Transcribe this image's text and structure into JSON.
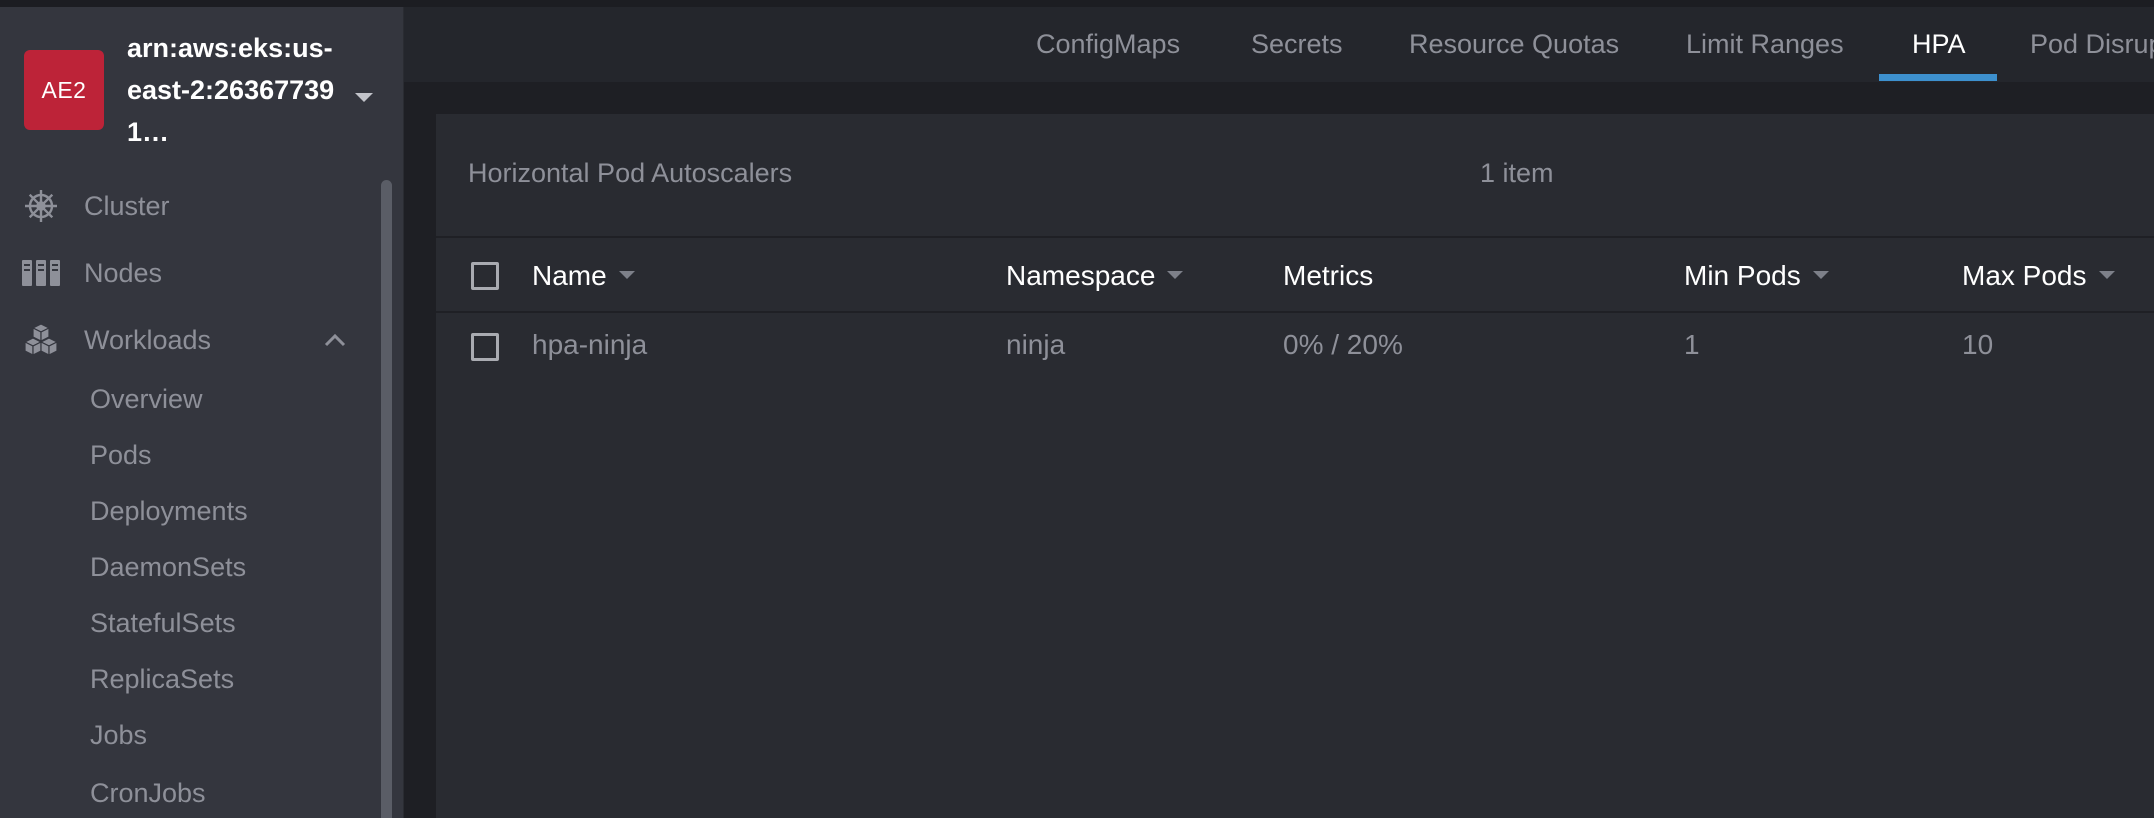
{
  "cluster": {
    "avatar_text": "AE2",
    "name": "arn:aws:eks:us-east-2:263677391…",
    "avatar_color": "#bd2338"
  },
  "sidebar": {
    "items": [
      {
        "label": "Cluster",
        "icon": "helm-wheel-icon"
      },
      {
        "label": "Nodes",
        "icon": "server-rack-icon"
      },
      {
        "label": "Workloads",
        "icon": "cubes-icon",
        "expanded": true
      }
    ],
    "workloads_children": [
      "Overview",
      "Pods",
      "Deployments",
      "DaemonSets",
      "StatefulSets",
      "ReplicaSets",
      "Jobs",
      "CronJobs"
    ]
  },
  "tabs": [
    {
      "label": "ConfigMaps",
      "active": false
    },
    {
      "label": "Secrets",
      "active": false
    },
    {
      "label": "Resource Quotas",
      "active": false
    },
    {
      "label": "Limit Ranges",
      "active": false
    },
    {
      "label": "HPA",
      "active": true
    },
    {
      "label": "Pod Disrup",
      "active": false
    }
  ],
  "panel": {
    "title": "Horizontal Pod Autoscalers",
    "count": "1 item"
  },
  "table": {
    "columns": [
      "Name",
      "Namespace",
      "Metrics",
      "Min Pods",
      "Max Pods"
    ],
    "rows": [
      {
        "name": "hpa-ninja",
        "namespace": "ninja",
        "metrics": "0% / 20%",
        "min_pods": "1",
        "max_pods": "10"
      }
    ]
  },
  "colors": {
    "accent": "#3d90ce",
    "sidebar_bg": "#34363e",
    "content_bg": "#292b31"
  }
}
